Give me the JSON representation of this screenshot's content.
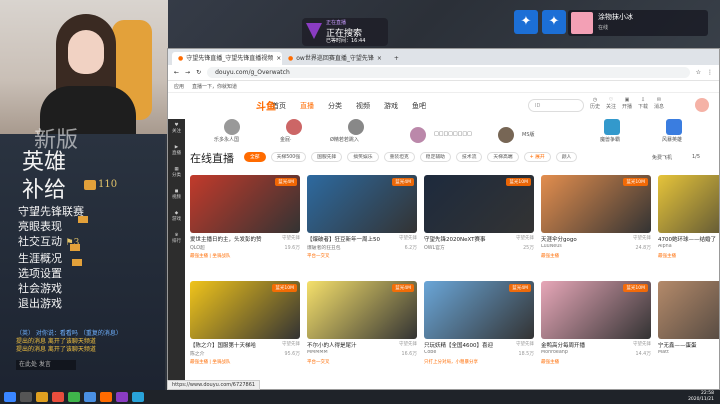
{
  "game": {
    "hud": {
      "l1": "英雄",
      "l2": "补给",
      "level": "110",
      "menu": [
        "守望先锋联赛",
        "亮眼表现",
        "社交互动",
        "生涯概况",
        "选项设置",
        "社会游戏",
        "退出游戏"
      ],
      "social_count": "3",
      "top": "新版"
    },
    "chat": [
      "（英） 对你说：看看吗 （重复的消息）",
      "提出的消息 离开了该聊天频道",
      "提出的消息 离开了该聊天频道"
    ],
    "chat_placeholder": "在此处 发言"
  },
  "notif": {
    "line1": "正在直播",
    "line2": "正在搜索",
    "line3": "已等时间：16:44"
  },
  "chatuser": {
    "name": "涂物抹小冰",
    "sub": "在线"
  },
  "browser": {
    "tabs": [
      {
        "label": "守望先锋直播_守望先锋直播视频",
        "active": true
      },
      {
        "label": "ow世界巡回赛直播_守望先锋",
        "active": false
      }
    ],
    "url": "douyu.com/g_Overwatch",
    "bookmarks": [
      "应用",
      "直播一下，你就知道"
    ],
    "status_url": "https://www.douyu.com/6727861"
  },
  "site": {
    "logo": "斗鱼",
    "nav": [
      {
        "label": "首页",
        "active": false
      },
      {
        "label": "直播",
        "active": true
      },
      {
        "label": "分类",
        "active": false
      },
      {
        "label": "视频",
        "active": false
      },
      {
        "label": "游戏",
        "active": false
      },
      {
        "label": "鱼吧",
        "active": false
      }
    ],
    "search_placeholder": "ID",
    "header_icons": [
      "历史",
      "关注",
      "开播",
      "下载",
      "消息"
    ],
    "sidebar": [
      "关注",
      "直播",
      "分类",
      "视频",
      "游戏",
      "排行"
    ],
    "followed": [
      "乐多永人国",
      "金屁·",
      "Ø精若若跳入",
      "□□□□□□□□",
      "MS版",
      "魔兽争霸",
      "风暴英雄"
    ],
    "section_title": "在线直播",
    "filters": [
      {
        "label": "全部",
        "active": true
      },
      {
        "label": "天梯500强",
        "active": false
      },
      {
        "label": "国服先锋",
        "active": false
      },
      {
        "label": "搞笑娱乐",
        "active": false
      },
      {
        "label": "重装坦克",
        "active": false
      },
      {
        "label": "稳定辅助",
        "active": false
      },
      {
        "label": "技术流",
        "active": false
      },
      {
        "label": "天梯高端",
        "active": false
      },
      {
        "label": "+ 展开",
        "active": false
      },
      {
        "label": "颜人",
        "active": false
      }
    ],
    "sort_label": "免费飞机",
    "sort_count": "1/5",
    "cards": [
      {
        "title": "爱世主播日的主，头发彭的赞",
        "cat": "守望先锋",
        "name": "QLO超",
        "heat": "19.6万",
        "tag": "最强主播 | 坐骑战队",
        "badge": "蓝光4M",
        "color": "#c23a2b"
      },
      {
        "title": "【爆破者】狂豆新年一周上50",
        "cat": "守望先锋",
        "name": "爆破者的狂丑包",
        "heat": "6.2万",
        "tag": "平台一交叉",
        "badge": "蓝光4M",
        "color": "#2d6aa0"
      },
      {
        "title": "守望先锋2020NeXT赛事",
        "cat": "守望先锋",
        "name": "OWL官方",
        "heat": "25万",
        "tag": "",
        "badge": "蓝光10M",
        "color": "#1d2a3d"
      },
      {
        "title": "天涯伞分gogo",
        "cat": "守望先锋",
        "name": "LuuNeus",
        "heat": "24.8万",
        "tag": "最强主播",
        "badge": "蓝光10M",
        "color": "#e38e4e"
      },
      {
        "title": "4700她环球——结婚了",
        "cat": "守望先锋",
        "name": "Alpha",
        "heat": "8.9万",
        "tag": "最强主播",
        "badge": "蓝光4M",
        "color": "#e6c43a"
      },
      {
        "title": "【陈之介】国服第十天梯哈",
        "cat": "守望先锋",
        "name": "陈之介",
        "heat": "95.6万",
        "tag": "最强主播 | 坐骑战队",
        "badge": "蓝光10M",
        "color": "#f0c41b"
      },
      {
        "title": "不尔小的人得是尾汁",
        "cat": "守望先锋",
        "name": "MMMMM",
        "heat": "16.6万",
        "tag": "平台一交叉",
        "badge": "蓝光4M",
        "color": "#f5e06b"
      },
      {
        "title": "只玩妖精【全国4600】喜迎",
        "cat": "守望先锋",
        "name": "Cobe",
        "heat": "18.5万",
        "tag": "只打上分对局，小粗暴分享",
        "badge": "蓝光4M",
        "color": "#6aa6d8"
      },
      {
        "title": "金鸭高分每周开播",
        "cat": "守望先锋",
        "name": "Monroeanp",
        "heat": "14.4万",
        "tag": "最强主播",
        "badge": "蓝光10M",
        "color": "#e7a7b8"
      },
      {
        "title": "宁无鑫——蛋蛋",
        "cat": "守望先锋",
        "name": "Matt",
        "heat": "5.4万",
        "tag": "",
        "badge": "蓝光4M",
        "color": "#b48a6a"
      }
    ]
  },
  "clock": {
    "time": "22:58",
    "date": "2020/11/21"
  },
  "colors": {
    "accent": "#ff6b00",
    "sidebar": "#2d2d2d",
    "taskbar": "#1f2329"
  }
}
